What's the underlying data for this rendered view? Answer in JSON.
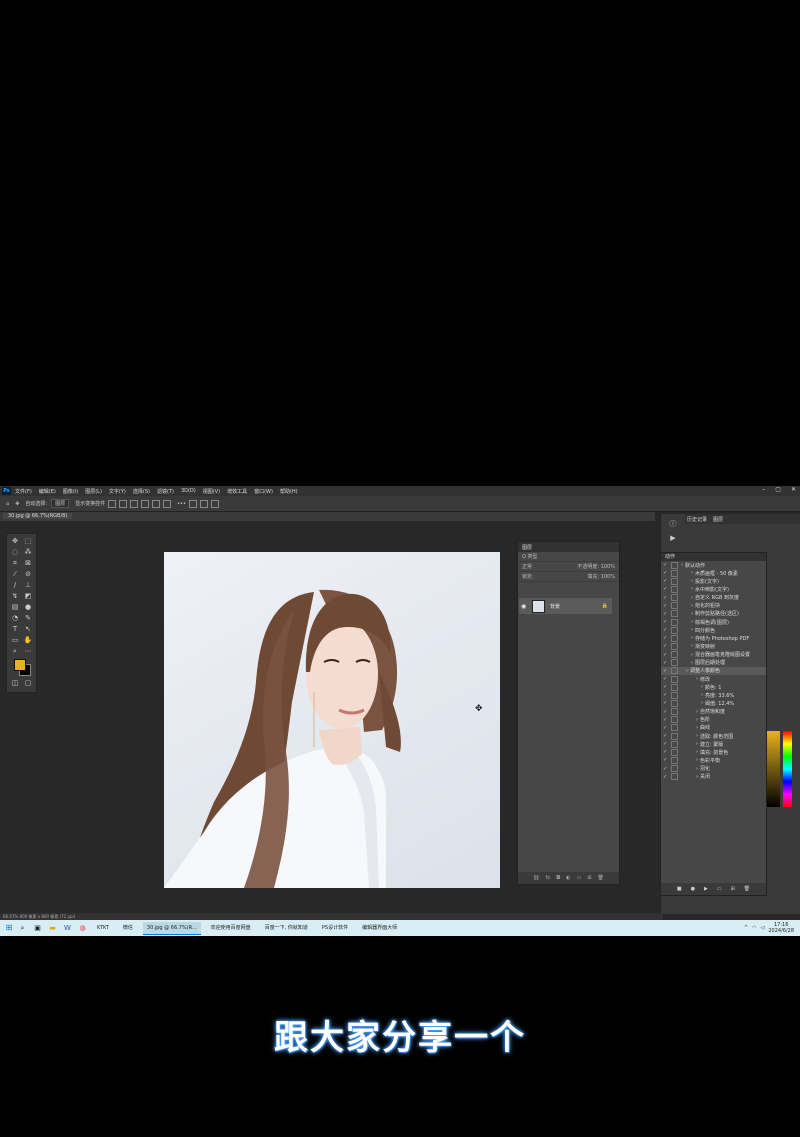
{
  "menubar": {
    "logo": "Ps",
    "items": [
      "文件(F)",
      "编辑(E)",
      "图像(I)",
      "图层(L)",
      "文字(Y)",
      "选择(S)",
      "滤镜(T)",
      "3D(D)",
      "视图(V)",
      "增效工具",
      "窗口(W)",
      "帮助(H)"
    ],
    "window_controls": [
      "–",
      "▢",
      "✕"
    ]
  },
  "optbar": {
    "auto_select": "自动选择:",
    "layer_select": "图层",
    "show_transform": "显示变换控件",
    "more": "•••"
  },
  "document": {
    "tab_title": "30.jpg @ 66.7%(RGB/8)"
  },
  "layers_panel": {
    "title": "图层",
    "search": "Q 类型",
    "blend": "正常",
    "opacity": "不透明度: 100%",
    "lock": "锁定:",
    "fill": "填充: 100%",
    "layer_name": "背景"
  },
  "right_panel": {
    "tabs": [
      "历史记录",
      "图层"
    ],
    "actions_title": "动作"
  },
  "actions": [
    "默认动作",
    "木质画框 - 50 像素",
    "投影(文字)",
    "水中倒影(文字)",
    "自定义 RGB 到灰度",
    "熔化的铅块",
    "制作剪贴路径(选区)",
    "棕褐色调(图层)",
    "四分颜色",
    "存储为 Photoshop PDF",
    "渐变映射",
    "混合器画笔克隆绘图设置",
    "图层后期处理",
    "调整人像颜色",
    "修改",
    "颜色: 1",
    "亮度: 33.6%",
    "阈值: 12.4%",
    "自然饱和度",
    "色阶",
    "曲线",
    "选取: 颜色范围",
    "建立: 蒙版",
    "填充: 前景色",
    "色彩平衡",
    "羽化",
    "关闭"
  ],
  "statusbar": {
    "text": "66.67%  800 像素 x 800 像素 (72 ppi)"
  },
  "taskbar": {
    "apps": [
      "微信",
      "30.jpg @ 66.7%(R...",
      "欢迎使用百度网盘",
      "百度一下, 你就知道",
      "PS设计软件",
      "编辑器界面大师"
    ],
    "search_app": "KTKT",
    "time": "17:16",
    "date": "2024/6/28"
  },
  "subtitle": "跟大家分享一个",
  "colors": {
    "foreground": "#e7b21f",
    "background": "#000000",
    "accent": "#31a8ff"
  }
}
